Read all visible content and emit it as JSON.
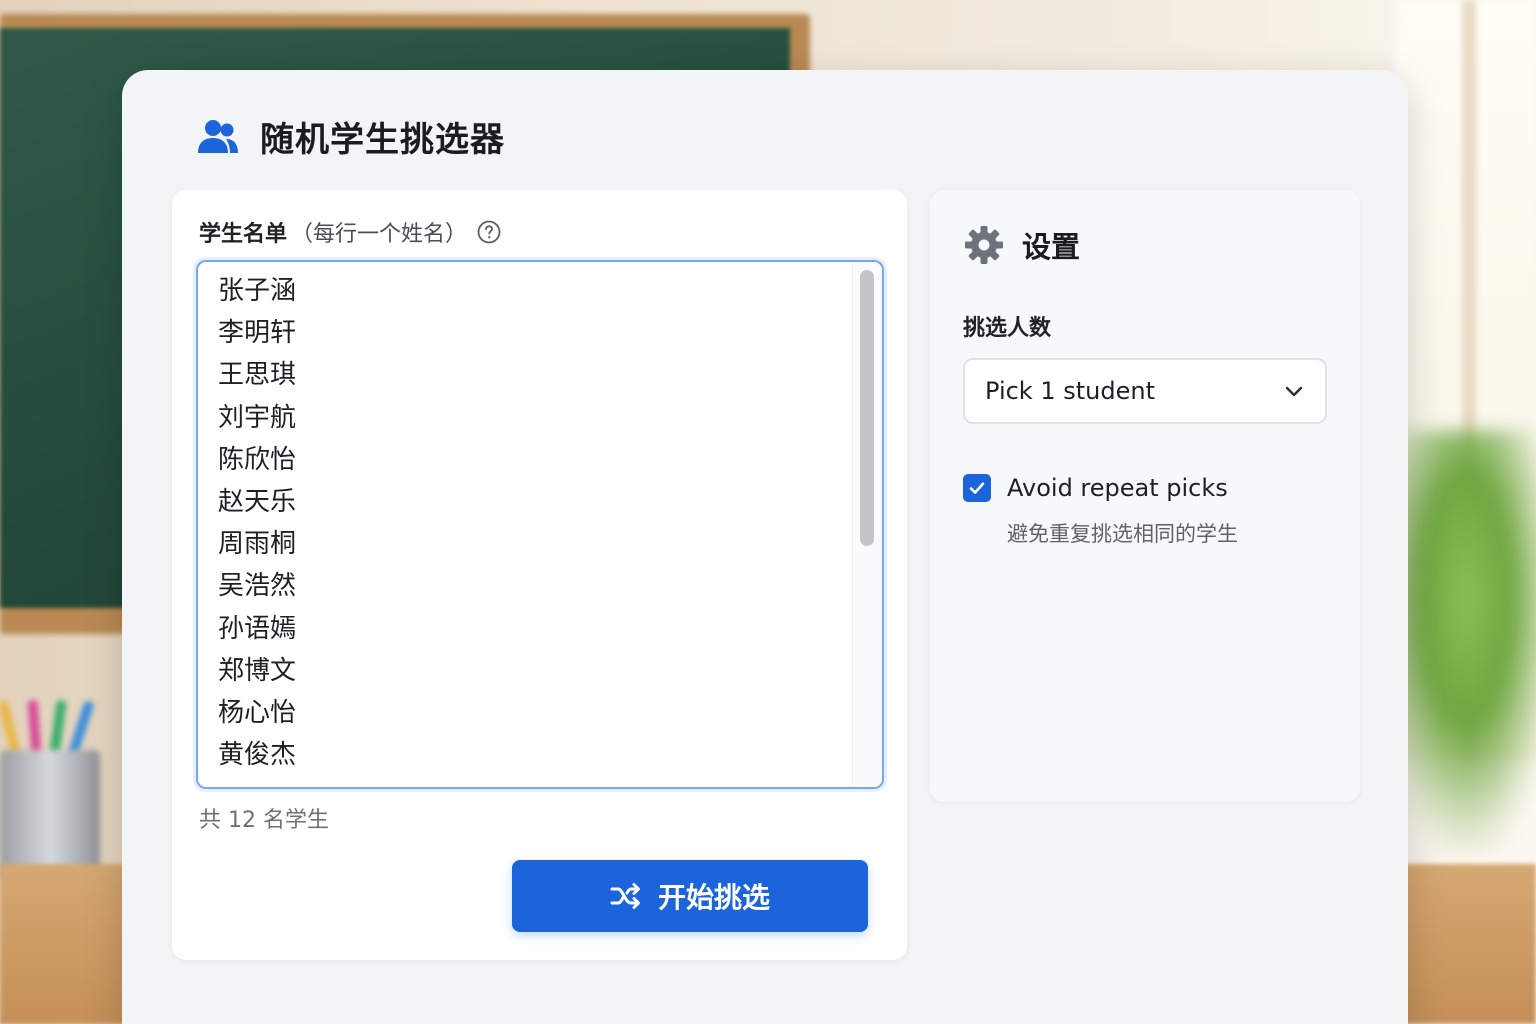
{
  "app": {
    "title": "随机学生挑选器",
    "title_icon": "users-icon"
  },
  "student_list": {
    "label": "学生名单",
    "label_hint": "（每行一个姓名）",
    "help_icon": "help-circle-icon",
    "names": [
      "张子涵",
      "李明轩",
      "王思琪",
      "刘宇航",
      "陈欣怡",
      "赵天乐",
      "周雨桐",
      "吴浩然",
      "孙语嫣",
      "郑博文",
      "杨心怡",
      "黄俊杰"
    ],
    "count_text": "共 12 名学生"
  },
  "pick_button": {
    "label": "开始挑选",
    "icon": "shuffle-icon"
  },
  "settings": {
    "title": "设置",
    "icon": "gear-icon",
    "pick_count_label": "挑选人数",
    "pick_count_value": "Pick 1 student",
    "avoid_repeat_label": "Avoid repeat picks",
    "avoid_repeat_checked": true,
    "avoid_repeat_hint": "避免重复挑选相同的学生"
  },
  "colors": {
    "accent": "#1c64dc",
    "focus_border": "#76a9f1",
    "panel_bg": "#f3f4f6"
  }
}
